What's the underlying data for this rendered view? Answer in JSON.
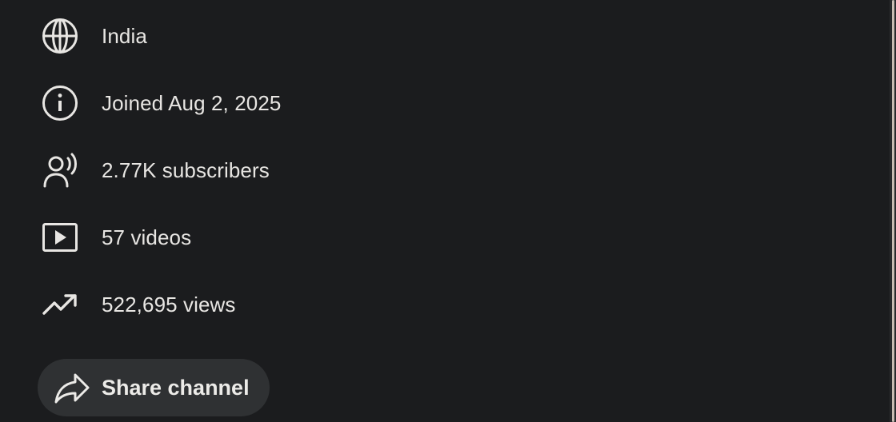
{
  "details": {
    "items": [
      {
        "icon": "globe-icon",
        "text": "India"
      },
      {
        "icon": "info-icon",
        "text": "Joined Aug 2, 2025"
      },
      {
        "icon": "subscribers-icon",
        "text": "2.77K subscribers"
      },
      {
        "icon": "video-play-icon",
        "text": "57 videos"
      },
      {
        "icon": "trending-up-icon",
        "text": "522,695 views"
      }
    ]
  },
  "share": {
    "label": "Share channel",
    "icon": "share-icon"
  },
  "colors": {
    "background": "#1b1c1e",
    "text": "#e8e6e3",
    "button": "#2f3133",
    "scrollbar_thumb": "#c9bdb3"
  }
}
